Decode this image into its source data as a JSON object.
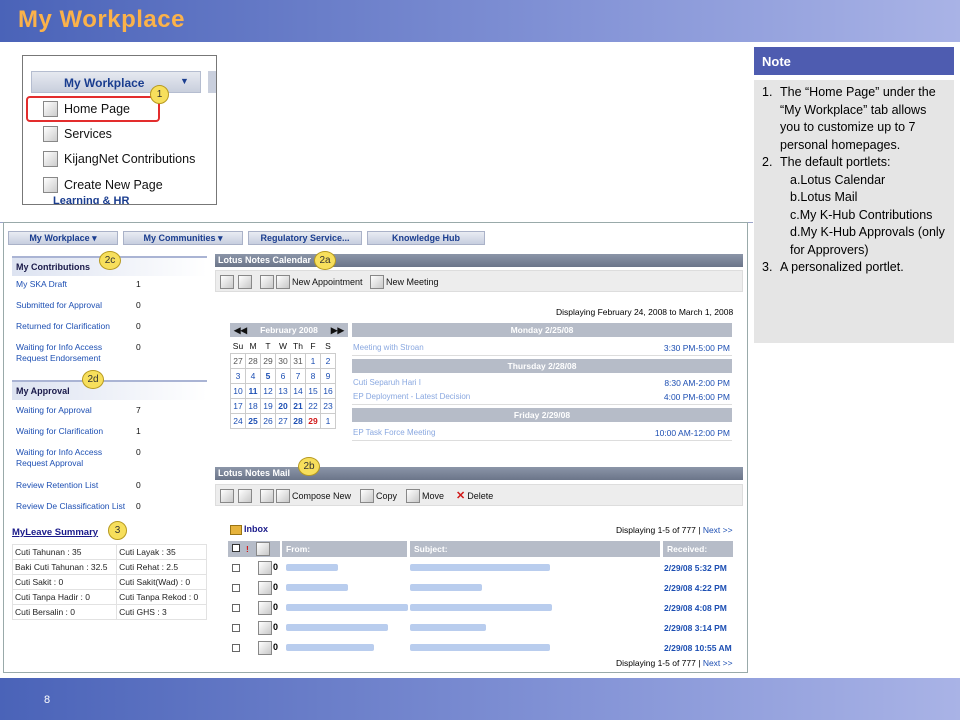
{
  "slide": {
    "title": "My Workplace",
    "page_number": "8"
  },
  "menu": {
    "header": "My Workplace",
    "items": [
      "Home Page",
      "Services",
      "KijangNet Contributions",
      "Create New Page"
    ],
    "cutoff_text": "Learning & HR"
  },
  "badges": {
    "b1": "1",
    "b2a": "2a",
    "b2b": "2b",
    "b2c": "2c",
    "b2d": "2d",
    "b3": "3"
  },
  "note": {
    "title": "Note",
    "items": [
      {
        "num": "1.",
        "text": "The “Home Page” under the “My Workplace” tab allows you to customize up to 7 personal homepages."
      },
      {
        "num": "2.",
        "text": "The default portlets:"
      },
      {
        "sub": "a.Lotus Calendar"
      },
      {
        "sub": "b.Lotus Mail"
      },
      {
        "sub": "c.My K-Hub Contributions"
      },
      {
        "sub": "d.My K-Hub Approvals (only for Approvers)"
      },
      {
        "num": "3.",
        "text": "A personalized portlet."
      }
    ]
  },
  "nav": {
    "tabs": [
      "My Workplace ▾",
      "My Communities ▾",
      "Regulatory Service...",
      "Knowledge Hub"
    ]
  },
  "contributions": {
    "title": "My Contributions",
    "rows": [
      {
        "label": "My SKA Draft",
        "value": "1"
      },
      {
        "label": "Submitted for Approval",
        "value": "0"
      },
      {
        "label": "Returned for Clarification",
        "value": "0"
      },
      {
        "label": "Waiting for Info Access Request Endorsement",
        "value": "0"
      }
    ]
  },
  "approval": {
    "title": "My Approval",
    "rows": [
      {
        "label": "Waiting for Approval",
        "value": "7"
      },
      {
        "label": "Waiting for Clarification",
        "value": "1"
      },
      {
        "label": "Waiting for Info Access Request Approval",
        "value": "0"
      },
      {
        "label": "Review Retention List",
        "value": "0"
      },
      {
        "label": "Review De Classification List",
        "value": "0"
      }
    ]
  },
  "leave": {
    "title": "MyLeave Summary",
    "cells": [
      [
        "Cuti Tahunan : 35",
        "Cuti Layak : 35"
      ],
      [
        "Baki Cuti Tahunan : 32.5",
        "Cuti Rehat : 2.5"
      ],
      [
        "Cuti Sakit : 0",
        "Cuti Sakit(Wad) : 0"
      ],
      [
        "Cuti Tanpa Hadir : 0",
        "Cuti Tanpa Rekod : 0"
      ],
      [
        "Cuti Bersalin : 0",
        "Cuti GHS : 3"
      ]
    ]
  },
  "calendar": {
    "title": "Lotus Notes Calendar",
    "new_appointment": "New Appointment",
    "new_meeting": "New Meeting",
    "displaying": "Displaying February 24, 2008 to March 1, 2008",
    "month": "February 2008",
    "weekdays": [
      "Su",
      "M",
      "T",
      "W",
      "Th",
      "F",
      "S"
    ],
    "weeks": [
      [
        "27",
        "28",
        "29",
        "30",
        "31",
        "1",
        "2"
      ],
      [
        "3",
        "4",
        "5",
        "6",
        "7",
        "8",
        "9"
      ],
      [
        "10",
        "11",
        "12",
        "13",
        "14",
        "15",
        "16"
      ],
      [
        "17",
        "18",
        "19",
        "20",
        "21",
        "22",
        "23"
      ],
      [
        "24",
        "25",
        "26",
        "27",
        "28",
        "29",
        "1"
      ]
    ],
    "days": [
      {
        "day": "Monday 2/25/08",
        "events": [
          {
            "title": "Meeting with Stroan",
            "time": "3:30 PM-5:00 PM"
          }
        ]
      },
      {
        "day": "Thursday 2/28/08",
        "events": [
          {
            "title": "Cuti Separuh Hari I",
            "time": "8:30 AM-2:00 PM"
          },
          {
            "title": "EP Deployment - Latest Decision",
            "time": "4:00 PM-6:00 PM"
          }
        ]
      },
      {
        "day": "Friday 2/29/08",
        "events": [
          {
            "title": "EP Task Force Meeting",
            "time": "10:00 AM-12:00 PM"
          }
        ]
      }
    ]
  },
  "mail": {
    "title": "Lotus Notes Mail",
    "toolbar": [
      "Compose New",
      "Copy",
      "Move",
      "Delete"
    ],
    "folder": "Inbox",
    "displaying": "Displaying 1-5 of 777 |",
    "next": "Next >>",
    "columns": [
      "From:",
      "Subject:",
      "Received:"
    ],
    "rows": [
      {
        "received": "2/29/08 5:32 PM"
      },
      {
        "received": "2/29/08 4:22 PM"
      },
      {
        "received": "2/29/08 4:08 PM"
      },
      {
        "received": "2/29/08 3:14 PM"
      },
      {
        "received": "2/29/08 10:55 AM"
      }
    ]
  }
}
